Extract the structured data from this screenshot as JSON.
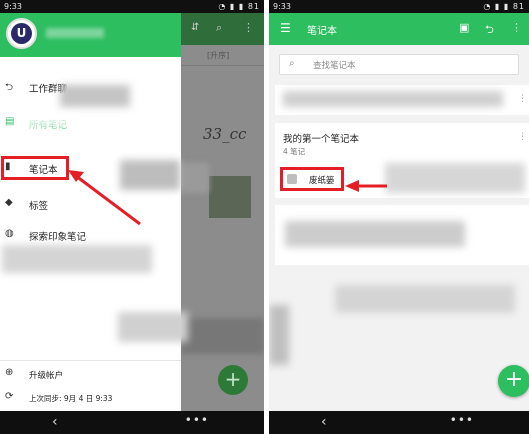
{
  "status_bar": {
    "time": "9:33",
    "signal": "◔ ▮ ▮ 81"
  },
  "left": {
    "avatar_letter": "U",
    "background_app": {
      "sort_label": "[升序]",
      "handwriting": "33_cc"
    },
    "drawer": {
      "items": [
        {
          "label": "工作群聊",
          "icon": "chat-icon"
        },
        {
          "label": "所有笔记",
          "icon": "notes-icon"
        },
        {
          "label": "笔记本",
          "icon": "notebook-icon"
        },
        {
          "label": "标签",
          "icon": "tag-icon"
        },
        {
          "label": "探索印象笔记",
          "icon": "globe-icon"
        }
      ],
      "upgrade": "升级帐户",
      "last_sync": "上次同步: 9月 4 日 9:33"
    }
  },
  "right": {
    "title": "笔记本",
    "search_placeholder": "查找笔记本",
    "notebook": {
      "title": "我的第一个笔记本",
      "count": "4 笔记"
    },
    "stack": "废纸篓"
  },
  "colors": {
    "accent": "#2dbe60",
    "highlight": "#e41e26",
    "dark_green": "#2f6d3a"
  }
}
